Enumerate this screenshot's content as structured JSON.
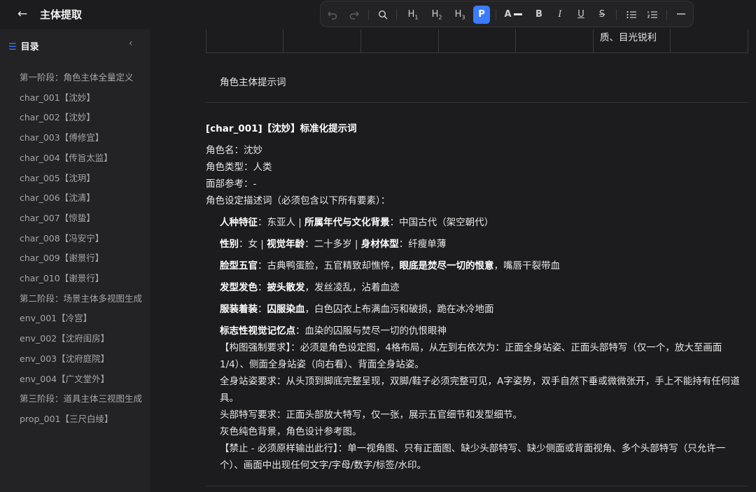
{
  "header": {
    "title": "主体提取"
  },
  "toolbar": {
    "h1": "H",
    "h2": "H",
    "h3": "H",
    "sub1": "1",
    "sub2": "2",
    "sub3": "3",
    "p": "P",
    "text_color": "A"
  },
  "toc": {
    "title": "目录",
    "items": [
      "第一阶段：角色主体全量定义",
      "char_001【沈妙】",
      "char_002【沈妙】",
      "char_003【傅修宜】",
      "char_004【传旨太监】",
      "char_005【沈玥】",
      "char_006【沈清】",
      "char_007【惊蛰】",
      "char_008【冯安宁】",
      "char_009【谢景行】",
      "char_010【谢景行】",
      "第二阶段：场景主体多视图生成",
      "env_001【冷宫】",
      "env_002【沈府闺房】",
      "env_003【沈府庭院】",
      "env_004【广文堂外】",
      "第三阶段：道具主体三视图生成",
      "prop_001【三尺白绫】"
    ]
  },
  "doc": {
    "table_cell": "质、目光锐利",
    "section_label": "角色主体提示词",
    "heading": "[char_001]【沈妙】标准化提示词",
    "name_line": "角色名：沈妙",
    "type_line": "角色类型：人类",
    "face_line": "面部参考：-",
    "desc_line": "角色设定描述词（必须包含以下所有要素）：",
    "race_k": "人种特征",
    "race_v": "：东亚人 | ",
    "era_k": "所属年代与文化背景",
    "era_v": "：中国古代（架空朝代）",
    "sex_k": "性别",
    "sex_v": "：女 | ",
    "age_k": "视觉年龄",
    "age_v": "：二十多岁 | ",
    "body_k": "身材体型",
    "body_v": "：纤瘦单薄",
    "face_k": "脸型五官",
    "face_v": "：古典鸭蛋脸，五官精致却憔悴，",
    "eye_k": "眼底是焚尽一切的恨意",
    "eye_v": "，嘴唇干裂带血",
    "hair_k": "发型发色",
    "hair_sep": "：",
    "hair_b": "披头散发",
    "hair_v": "，发丝凌乱，沾着血迹",
    "cloth_k": "服装着装",
    "cloth_sep": "：",
    "cloth_b": "囚服染血",
    "cloth_v": "，白色囚衣上布满血污和破损，跪在冰冷地面",
    "mark_k": "标志性视觉记忆点",
    "mark_v": "：血染的囚服与焚尽一切的仇恨眼神",
    "comp1": "【构图强制要求】：必须是角色设定图，4格布局，从左到右依次为：正面全身站姿、正面头部特写（仅一个，放大至画面",
    "comp2": "1/4）、侧面全身站姿（向右看）、背面全身站姿。",
    "full1": "全身站姿要求：从头顶到脚底完整呈现，双脚/鞋子必须完整可见，A字姿势，双手自然下垂或微微张开，手上不能持有任何道",
    "full2": "具。",
    "head_line": "头部特写要求：正面头部放大特写，仅一张，展示五官细节和发型细节。",
    "bg_line": "灰色纯色背景，角色设计参考图。",
    "ban1": "【禁止 - 必须原样输出此行】：单一视角图、只有正面图、缺少头部特写、缺少侧面或背面视角、多个头部特写（只允许一",
    "ban2": "个）、画面中出现任何文字/字母/数字/标签/水印。"
  }
}
